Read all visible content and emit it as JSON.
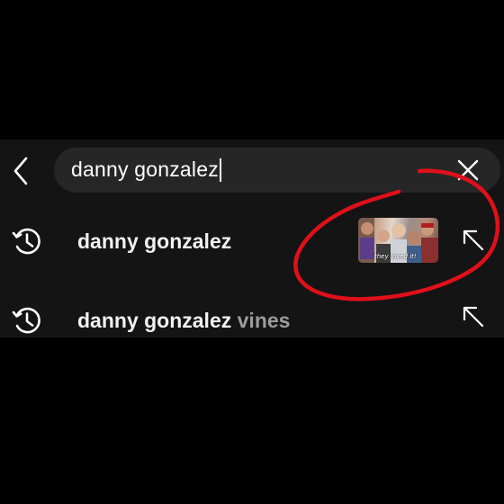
{
  "search": {
    "value": "danny gonzalez"
  },
  "suggestions": [
    {
      "label": "danny gonzalez",
      "label_suffix": "",
      "has_thumbnail": true,
      "thumbnail_caption": "they loved it!"
    },
    {
      "label": "danny gonzalez",
      "label_suffix": " vines",
      "has_thumbnail": false
    }
  ],
  "icons": {
    "back": "chevron-left-icon",
    "clear": "close-icon",
    "history": "history-icon",
    "fill": "arrow-up-left-icon"
  },
  "colors": {
    "background": "#000000",
    "panel": "#141414",
    "search_bar": "#262626",
    "text": "#f2f2f2",
    "suggestion_suffix": "#9c9c9c",
    "annotation": "#e0101a"
  }
}
